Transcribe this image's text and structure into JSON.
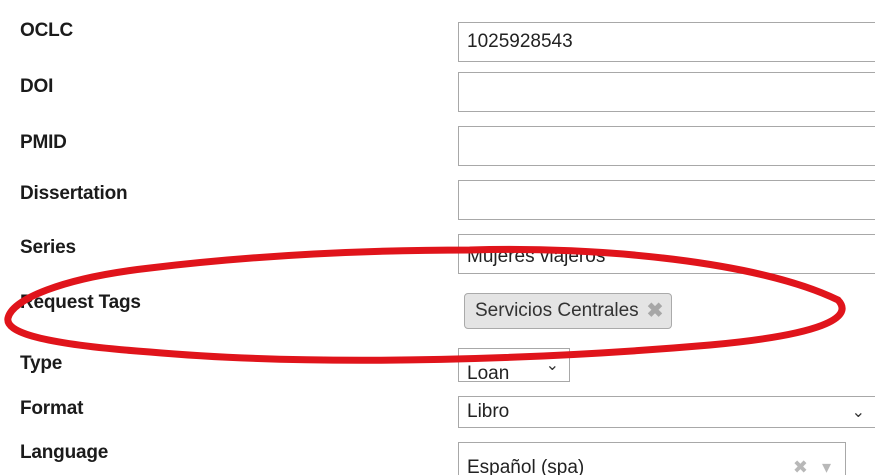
{
  "fields": {
    "oclc": {
      "label": "OCLC",
      "value": "1025928543"
    },
    "doi": {
      "label": "DOI",
      "value": ""
    },
    "pmid": {
      "label": "PMID",
      "value": ""
    },
    "dissertation": {
      "label": "Dissertation",
      "value": ""
    },
    "series": {
      "label": "Series",
      "value": "Mujeres viajeros"
    },
    "request_tags": {
      "label": "Request Tags",
      "tags": [
        "Servicios Centrales"
      ]
    },
    "type": {
      "label": "Type",
      "value": "Loan"
    },
    "format": {
      "label": "Format",
      "value": "Libro"
    },
    "language": {
      "label": "Language",
      "value": "Español (spa)"
    }
  },
  "annotation": {
    "color": "#e0141b",
    "shape": "ellipse around Request Tags row"
  },
  "icons": {
    "tag_remove": "close-icon",
    "select_arrow": "chevron-down-icon",
    "clear": "clear-icon"
  }
}
